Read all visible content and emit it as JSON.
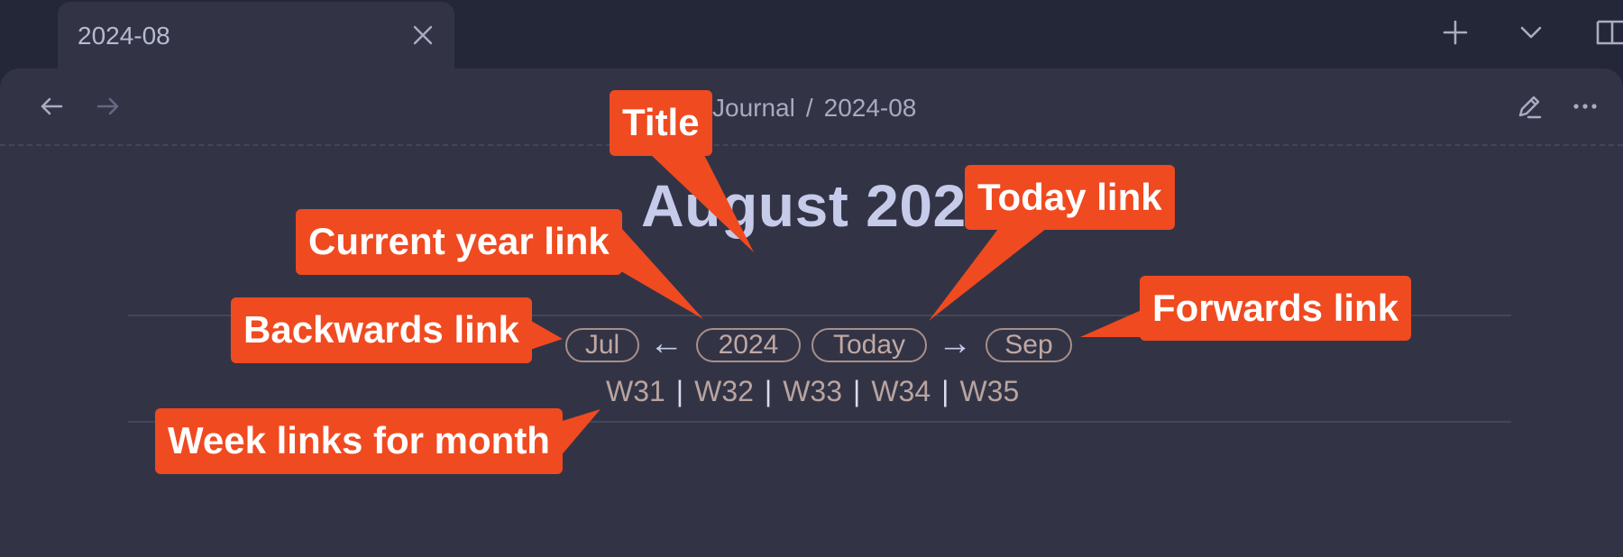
{
  "tab": {
    "title": "2024-08"
  },
  "breadcrumb": {
    "parent": "Journal",
    "separator": "/",
    "current": "2024-08"
  },
  "note": {
    "title": "August 2024",
    "nav": {
      "previous": "Jul",
      "year": "2024",
      "today": "Today",
      "next": "Sep",
      "back_arrow": "←",
      "forward_arrow": "→"
    },
    "weeks": [
      "W31",
      "W32",
      "W33",
      "W34",
      "W35"
    ]
  },
  "callouts": {
    "title": "Title",
    "today": "Today link",
    "year": "Current year link",
    "forwards": "Forwards link",
    "backwards": "Backwards link",
    "weeks": "Week links for month"
  },
  "colors": {
    "callout": "#f04a20",
    "background": "#323446",
    "title": "#c6cbea",
    "link": "#c2a8a2"
  },
  "icons": [
    "close-icon",
    "new-tab-icon",
    "tab-list-icon",
    "sidebar-toggle-icon",
    "back-arrow-icon",
    "forward-arrow-icon",
    "edit-icon",
    "more-options-icon"
  ]
}
